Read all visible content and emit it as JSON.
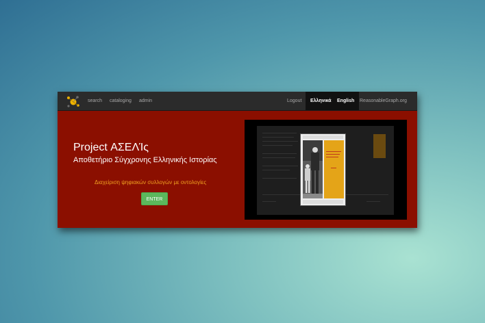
{
  "navbar": {
    "left_items": [
      {
        "label": "search"
      },
      {
        "label": "cataloging"
      },
      {
        "label": "admin"
      }
    ],
    "right_items": [
      {
        "label": "Logout",
        "active": false
      },
      {
        "label": "Ελληνικά",
        "active": true
      },
      {
        "label": "English",
        "active": true
      },
      {
        "label": "ReasonableGraph.org",
        "active": false
      }
    ]
  },
  "hero": {
    "title": "Project ΑΣΕΛΊς",
    "subtitle": "Αποθετήριο Σύγχρονης Ελληνικής Ιστορίας",
    "tagline": "Διαχείριση ψηφιακών συλλογών με οντολογίες",
    "enter_label": "ENTER"
  },
  "colors": {
    "hero_background": "#8b0f00",
    "navbar_background": "#2b2b2b",
    "tagline": "#f0a020",
    "enter_button": "#5cb85c",
    "book_cover": "#e4a418"
  },
  "icons": {
    "logo": "molecule-logo-icon"
  }
}
